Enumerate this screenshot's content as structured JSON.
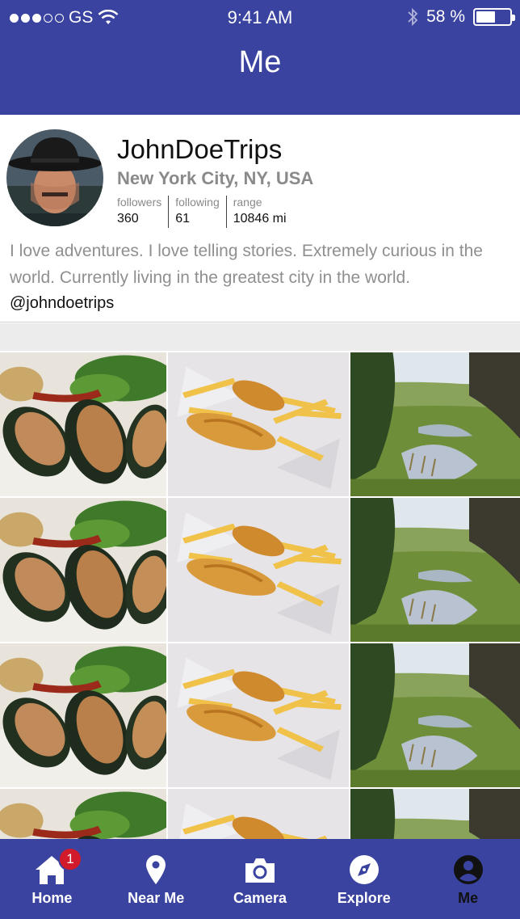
{
  "status_bar": {
    "carrier": "GS",
    "time": "9:41 AM",
    "battery_percent": "58 %",
    "battery_level": 0.58,
    "signal_bars_filled": 3,
    "signal_bars_total": 5
  },
  "nav": {
    "title": "Me"
  },
  "profile": {
    "username": "JohnDoeTrips",
    "location": "New York City, NY, USA",
    "stats": [
      {
        "label": "followers",
        "value": "360"
      },
      {
        "label": "following",
        "value": "61"
      },
      {
        "label": "range",
        "value": "10846 mi"
      }
    ],
    "bio": "I love adventures. I love telling stories. Extremely curious in the world. Currently living in the greatest city in the world.",
    "handle": "@johndoetrips"
  },
  "grid": {
    "columns": [
      "mussels-photo",
      "fish-and-chips-photo",
      "river-landscape-photo"
    ],
    "rows_visible": 4
  },
  "tabbar": {
    "items": [
      {
        "label": "Home",
        "icon": "home-icon",
        "badge": "1"
      },
      {
        "label": "Near Me",
        "icon": "location-pin-icon"
      },
      {
        "label": "Camera",
        "icon": "camera-icon"
      },
      {
        "label": "Explore",
        "icon": "compass-icon"
      },
      {
        "label": "Me",
        "icon": "user-icon",
        "active": true
      }
    ]
  },
  "colors": {
    "brand": "#3a43a0",
    "badge": "#d11a2a"
  }
}
